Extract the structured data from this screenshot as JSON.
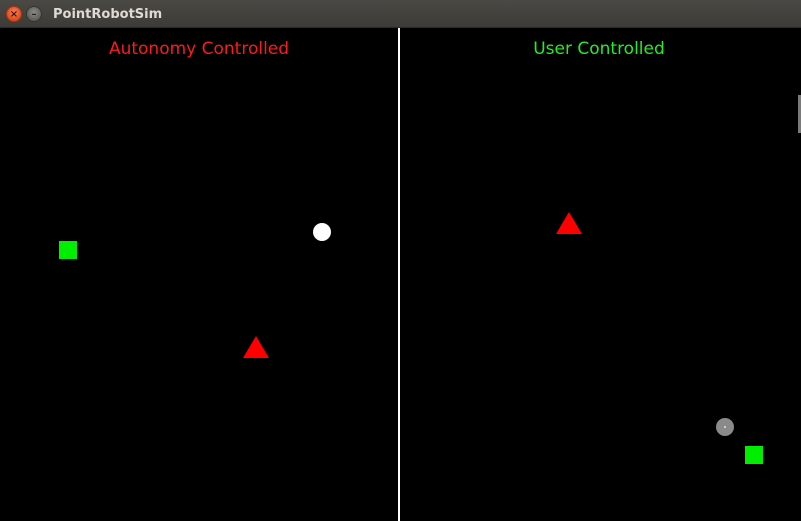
{
  "window": {
    "title": "PointRobotSim",
    "close_glyph": "×",
    "minimize_glyph": "–"
  },
  "panels": {
    "left": {
      "label": "Autonomy Controlled",
      "label_color": "#ff1a1a"
    },
    "right": {
      "label": "User Controlled",
      "label_color": "#22ee22"
    }
  },
  "icons": {
    "goal": "green-square-goal-icon",
    "robot": "circle-robot-icon",
    "obstacle": "red-triangle-obstacle-icon"
  },
  "colors": {
    "background": "#000000",
    "goal": "#00ee00",
    "obstacle": "#ff0000",
    "autonomy_robot": "#ffffff",
    "user_robot": "#8a8a8a",
    "divider": "#ffffff"
  }
}
